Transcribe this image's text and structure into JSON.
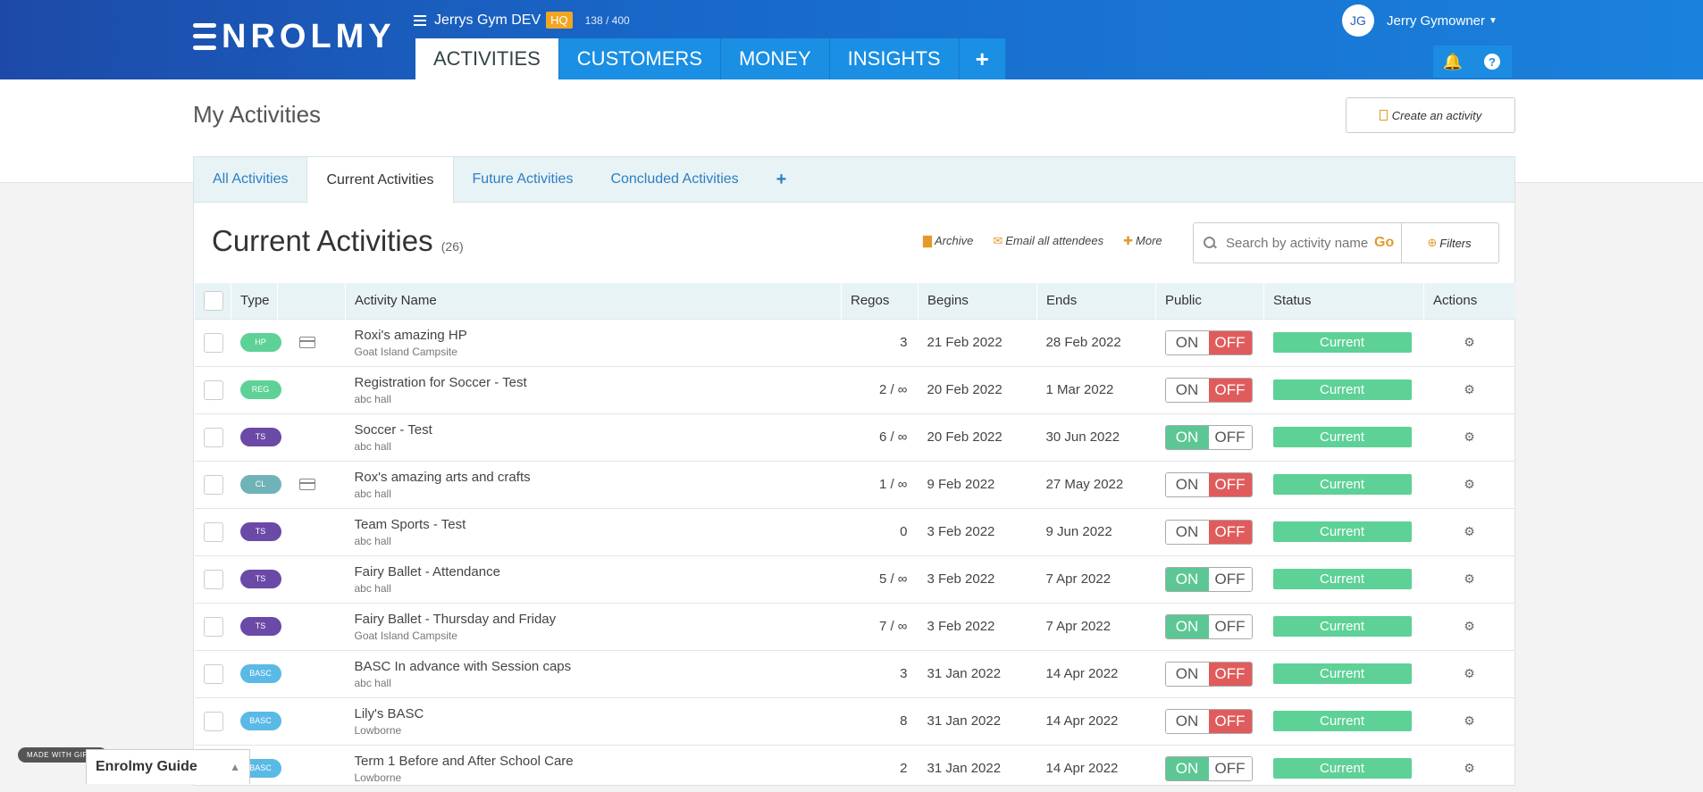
{
  "header": {
    "logo": "NROLMY",
    "org_name": "Jerrys Gym DEV",
    "org_badge": "HQ",
    "quota": "138 / 400",
    "user_initials": "JG",
    "user_name": "Jerry Gymowner",
    "nav": [
      "ACTIVITIES",
      "CUSTOMERS",
      "MONEY",
      "INSIGHTS"
    ],
    "nav_plus": "+",
    "icons": [
      "bell-icon",
      "help-icon"
    ]
  },
  "page": {
    "title": "My Activities",
    "create_button": "Create an activity"
  },
  "subtabs": [
    "All Activities",
    "Current Activities",
    "Future Activities",
    "Concluded Activities"
  ],
  "subtab_plus": "+",
  "list": {
    "title": "Current Activities",
    "count": "(26)",
    "archive": "Archive",
    "email_all": "Email all attendees",
    "more": "More",
    "search_placeholder": "Search by activity name",
    "go": "Go",
    "filters": "Filters"
  },
  "table": {
    "headers": {
      "type": "Type",
      "name": "Activity Name",
      "regos": "Regos",
      "begins": "Begins",
      "ends": "Ends",
      "public": "Public",
      "status": "Status",
      "actions": "Actions"
    },
    "toggle_on": "ON",
    "toggle_off": "OFF",
    "rows": [
      {
        "type": "HP",
        "color": "#5ed197",
        "card": true,
        "name": "Roxi's amazing HP",
        "location": "Goat Island Campsite",
        "regos": "3",
        "begins": "21 Feb 2022",
        "ends": "28 Feb 2022",
        "public": false,
        "status": "Current"
      },
      {
        "type": "REG",
        "color": "#5ed197",
        "card": false,
        "name": "Registration for Soccer - Test",
        "location": "abc hall",
        "regos": "2 / ∞",
        "begins": "20 Feb 2022",
        "ends": "1 Mar 2022",
        "public": false,
        "status": "Current"
      },
      {
        "type": "TS",
        "color": "#6a4aa6",
        "card": false,
        "name": "Soccer - Test",
        "location": "abc hall",
        "regos": "6 / ∞",
        "begins": "20 Feb 2022",
        "ends": "30 Jun 2022",
        "public": true,
        "status": "Current"
      },
      {
        "type": "CL",
        "color": "#6fb3b8",
        "card": true,
        "name": "Rox's amazing arts and crafts",
        "location": "abc hall",
        "regos": "1 / ∞",
        "begins": "9 Feb 2022",
        "ends": "27 May 2022",
        "public": false,
        "status": "Current"
      },
      {
        "type": "TS",
        "color": "#6a4aa6",
        "card": false,
        "name": "Team Sports - Test",
        "location": "abc hall",
        "regos": "0",
        "begins": "3 Feb 2022",
        "ends": "9 Jun 2022",
        "public": false,
        "status": "Current"
      },
      {
        "type": "TS",
        "color": "#6a4aa6",
        "card": false,
        "name": "Fairy Ballet - Attendance",
        "location": "abc hall",
        "regos": "5 / ∞",
        "begins": "3 Feb 2022",
        "ends": "7 Apr 2022",
        "public": true,
        "status": "Current"
      },
      {
        "type": "TS",
        "color": "#6a4aa6",
        "card": false,
        "name": "Fairy Ballet - Thursday and Friday",
        "location": "Goat Island Campsite",
        "regos": "7 / ∞",
        "begins": "3 Feb 2022",
        "ends": "7 Apr 2022",
        "public": true,
        "status": "Current"
      },
      {
        "type": "BASC",
        "color": "#5bb9e6",
        "card": false,
        "name": "BASC In advance with Session caps",
        "location": "abc hall",
        "regos": "3",
        "begins": "31 Jan 2022",
        "ends": "14 Apr 2022",
        "public": false,
        "status": "Current"
      },
      {
        "type": "BASC",
        "color": "#5bb9e6",
        "card": false,
        "name": "Lily's BASC",
        "location": "Lowborne",
        "regos": "8",
        "begins": "31 Jan 2022",
        "ends": "14 Apr 2022",
        "public": false,
        "status": "Current"
      },
      {
        "type": "BASC",
        "color": "#5bb9e6",
        "card": false,
        "name": "Term 1 Before and After School Care",
        "location": "Lowborne",
        "regos": "2",
        "begins": "31 Jan 2022",
        "ends": "14 Apr 2022",
        "public": true,
        "status": "Current"
      }
    ]
  },
  "widgets": {
    "gifox": "MADE WITH GIFOX",
    "guide": "Enrolmy Guide"
  }
}
